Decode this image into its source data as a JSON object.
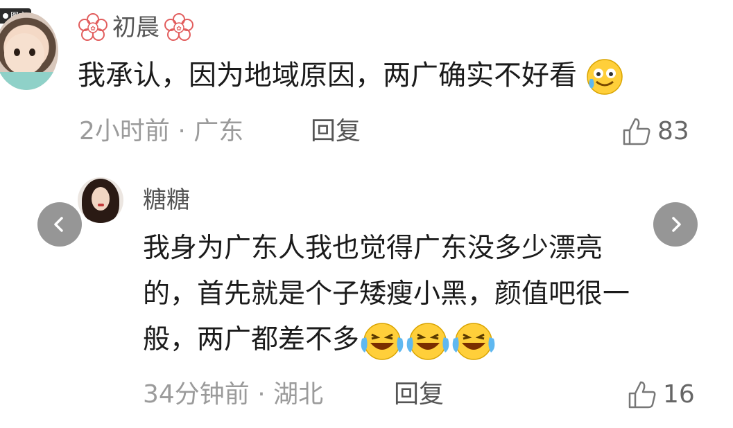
{
  "badge": {
    "label": "图文"
  },
  "comment": {
    "user": "初晨",
    "text": "我承认，因为地域原因，两广确实不好看",
    "time_location": "2小时前 · 广东",
    "reply_label": "回复",
    "likes": "83"
  },
  "reply": {
    "user": "糖糖",
    "lines": [
      "我身为广东人我也觉得广东没多少漂亮",
      "的，首先就是个子矮瘦小黑，颜值吧很一",
      "般，两广都差不多"
    ],
    "time_location": "34分钟前 · 湖北",
    "reply_label": "回复",
    "likes": "16"
  },
  "icons": {
    "flower": "flower-badge-icon",
    "emoji_shy": "sweat-smile-emoji-icon",
    "emoji_laugh": "laughing-crying-emoji-icon",
    "like": "thumbs-up-icon",
    "prev": "chevron-left-icon",
    "next": "chevron-right-icon"
  },
  "colors": {
    "text": "#1b1b1b",
    "meta": "#9b9b9b",
    "flower": "#e25d5d"
  }
}
